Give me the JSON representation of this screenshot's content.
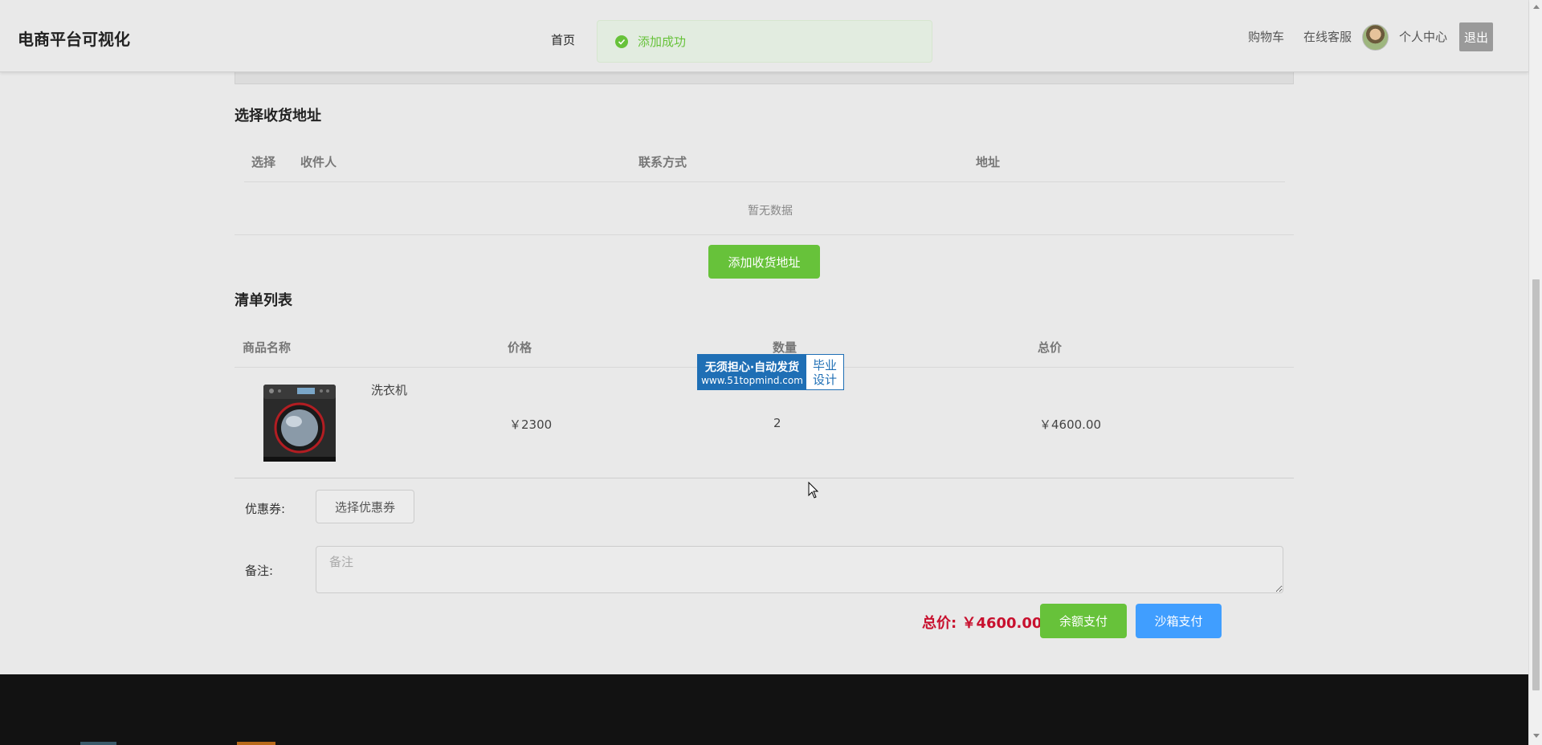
{
  "header": {
    "brand": "电商平台可视化",
    "nav_home": "首页",
    "toast": "添加成功",
    "cart": "购物车",
    "service": "在线客服",
    "profile": "个人中心",
    "logout": "退出"
  },
  "address": {
    "title": "选择收货地址",
    "columns": [
      "选择",
      "收件人",
      "联系方式",
      "地址"
    ],
    "empty_text": "暂无数据",
    "add_button": "添加收货地址"
  },
  "order_list": {
    "title": "清单列表",
    "columns": [
      "商品名称",
      "价格",
      "数量",
      "总价"
    ],
    "rows": [
      {
        "name": "洗衣机",
        "price": "￥2300",
        "quantity": "2",
        "total": "￥4600.00"
      }
    ]
  },
  "watermark": {
    "line1": "无须担心·自动发货",
    "line2": "www.51topmind.com",
    "right1": "毕业",
    "right2": "设计"
  },
  "coupon": {
    "label": "优惠券:",
    "button": "选择优惠券"
  },
  "remark": {
    "label": "备注:",
    "placeholder": "备注"
  },
  "summary": {
    "total": "总价: ￥4600.00",
    "balance_pay": "余额支付",
    "sandbox_pay": "沙箱支付"
  },
  "colors": {
    "success": "#67c23a",
    "primary": "#409eff",
    "price_red": "#c8102e"
  }
}
